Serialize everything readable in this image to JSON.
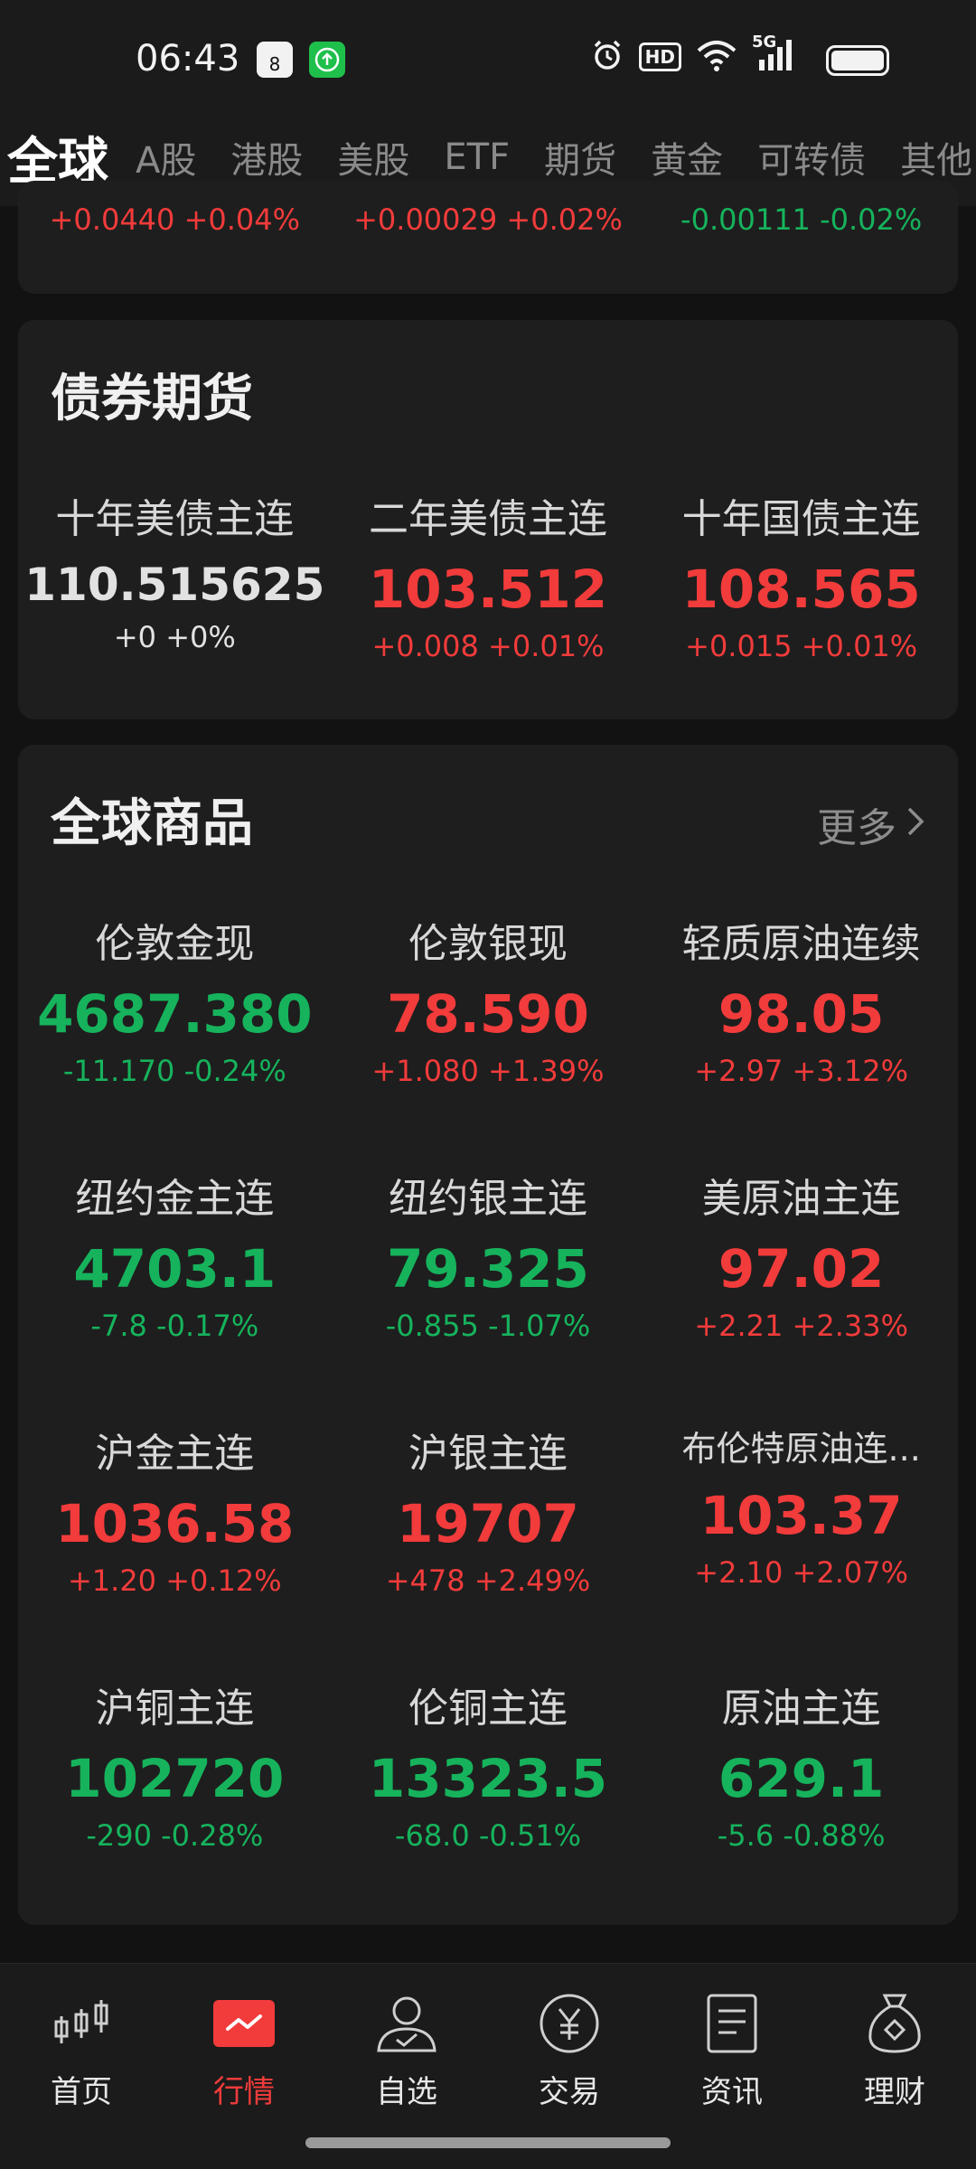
{
  "status": {
    "time": "06:43",
    "calendar_day": "8",
    "hd": "HD",
    "network": "5G"
  },
  "tabs": [
    {
      "label": "全球",
      "active": true
    },
    {
      "label": "A股"
    },
    {
      "label": "港股"
    },
    {
      "label": "美股"
    },
    {
      "label": "ETF"
    },
    {
      "label": "期货"
    },
    {
      "label": "黄金"
    },
    {
      "label": "可转债"
    },
    {
      "label": "其他"
    }
  ],
  "top_partial": [
    {
      "change": "+0.0440 +0.04%",
      "dir": "up"
    },
    {
      "change": "+0.00029 +0.02%",
      "dir": "up"
    },
    {
      "change": "-0.00111 -0.02%",
      "dir": "down"
    }
  ],
  "bonds": {
    "title": "债券期货",
    "items": [
      {
        "name": "十年美债主连",
        "price": "110.515625",
        "change": "+0 +0%",
        "dir": "flat"
      },
      {
        "name": "二年美债主连",
        "price": "103.512",
        "change": "+0.008 +0.01%",
        "dir": "up"
      },
      {
        "name": "十年国债主连",
        "price": "108.565",
        "change": "+0.015 +0.01%",
        "dir": "up"
      }
    ]
  },
  "commodities": {
    "title": "全球商品",
    "more": "更多",
    "items": [
      {
        "name": "伦敦金现",
        "price": "4687.380",
        "change": "-11.170 -0.24%",
        "dir": "down"
      },
      {
        "name": "伦敦银现",
        "price": "78.590",
        "change": "+1.080 +1.39%",
        "dir": "up"
      },
      {
        "name": "轻质原油连续",
        "price": "98.05",
        "change": "+2.97 +3.12%",
        "dir": "up"
      },
      {
        "name": "纽约金主连",
        "price": "4703.1",
        "change": "-7.8 -0.17%",
        "dir": "down"
      },
      {
        "name": "纽约银主连",
        "price": "79.325",
        "change": "-0.855 -1.07%",
        "dir": "down"
      },
      {
        "name": "美原油主连",
        "price": "97.02",
        "change": "+2.21 +2.33%",
        "dir": "up"
      },
      {
        "name": "沪金主连",
        "price": "1036.58",
        "change": "+1.20 +0.12%",
        "dir": "up"
      },
      {
        "name": "沪银主连",
        "price": "19707",
        "change": "+478 +2.49%",
        "dir": "up"
      },
      {
        "name": "布伦特原油连...",
        "price": "103.37",
        "change": "+2.10 +2.07%",
        "dir": "up"
      },
      {
        "name": "沪铜主连",
        "price": "102720",
        "change": "-290 -0.28%",
        "dir": "down"
      },
      {
        "name": "伦铜主连",
        "price": "13323.5",
        "change": "-68.0 -0.51%",
        "dir": "down"
      },
      {
        "name": "原油主连",
        "price": "629.1",
        "change": "-5.6 -0.88%",
        "dir": "down"
      }
    ]
  },
  "nav": [
    {
      "label": "首页",
      "icon": "candlestick-icon"
    },
    {
      "label": "行情",
      "icon": "market-chart-icon",
      "active": true
    },
    {
      "label": "自选",
      "icon": "user-check-icon"
    },
    {
      "label": "交易",
      "icon": "yen-circle-icon"
    },
    {
      "label": "资讯",
      "icon": "document-icon"
    },
    {
      "label": "理财",
      "icon": "money-bag-icon"
    }
  ],
  "colors": {
    "up": "#f23b3b",
    "down": "#16b35c",
    "flat": "#e2e2e2",
    "background": "#121212",
    "card": "#1e1e1e"
  }
}
